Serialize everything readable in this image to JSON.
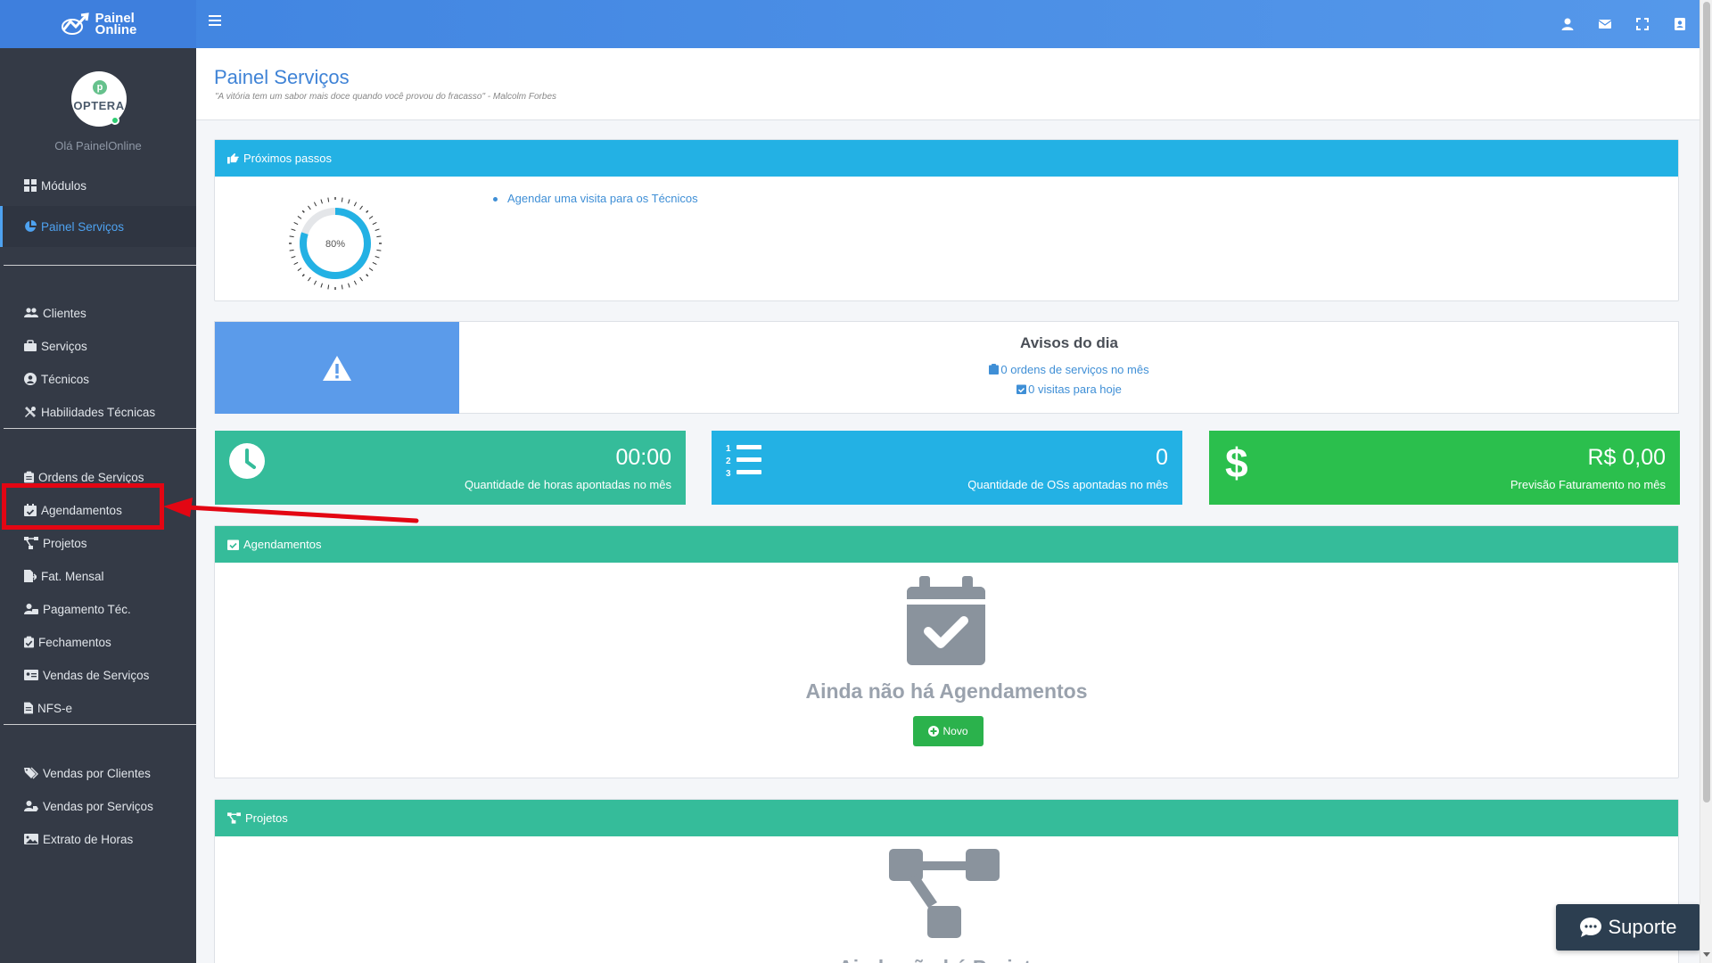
{
  "brand": {
    "name_line1": "Painel",
    "name_line2": "Online"
  },
  "user": {
    "greeting": "Olá PainelOnline",
    "avatar_text": "OPTERA"
  },
  "sidebar": {
    "items": [
      {
        "label": "Módulos"
      },
      {
        "label": "Painel Serviços"
      },
      {
        "label": "Clientes"
      },
      {
        "label": "Serviços"
      },
      {
        "label": "Técnicos"
      },
      {
        "label": "Habilidades Técnicas"
      },
      {
        "label": "Ordens de Serviços"
      },
      {
        "label": "Agendamentos"
      },
      {
        "label": "Projetos"
      },
      {
        "label": "Fat. Mensal"
      },
      {
        "label": "Pagamento Téc."
      },
      {
        "label": "Fechamentos"
      },
      {
        "label": "Vendas de Serviços"
      },
      {
        "label": "NFS-e"
      },
      {
        "label": "Vendas por Clientes"
      },
      {
        "label": "Vendas por Serviços"
      },
      {
        "label": "Extrato de Horas"
      }
    ]
  },
  "header": {
    "title": "Painel Serviços",
    "quote": "\"A vitória tem um sabor mais doce quando você provou do fracasso\" - Malcolm Forbes"
  },
  "next_steps": {
    "title": "Próximos passos",
    "progress": 80,
    "progress_label": "80%",
    "items": [
      "Agendar uma visita para os Técnicos"
    ]
  },
  "notices": {
    "title": "Avisos do dia",
    "orders_text": "0 ordens de serviços no mês",
    "visits_text": "0 visitas para hoje"
  },
  "stats": {
    "hours": {
      "value": "00:00",
      "label": "Quantidade de horas apontadas no mês",
      "color": "#35bc9a"
    },
    "orders": {
      "value": "0",
      "label": "Quantidade de OSs apontadas no mês",
      "color": "#23b1e4"
    },
    "billing": {
      "value": "R$ 0,00",
      "label": "Previsão Faturamento no mês",
      "color": "#2bbf4d"
    }
  },
  "schedules": {
    "title": "Agendamentos",
    "empty_text": "Ainda não há Agendamentos",
    "new_button": "Novo"
  },
  "projects": {
    "title": "Projetos",
    "empty_text": "Ainda não há Projetos"
  },
  "support": {
    "label": "Suporte"
  },
  "colors": {
    "topbar": "#4a8fe6",
    "sidebar": "#343a46",
    "accent": "#4ea2f0",
    "highlight": "#e30613"
  }
}
